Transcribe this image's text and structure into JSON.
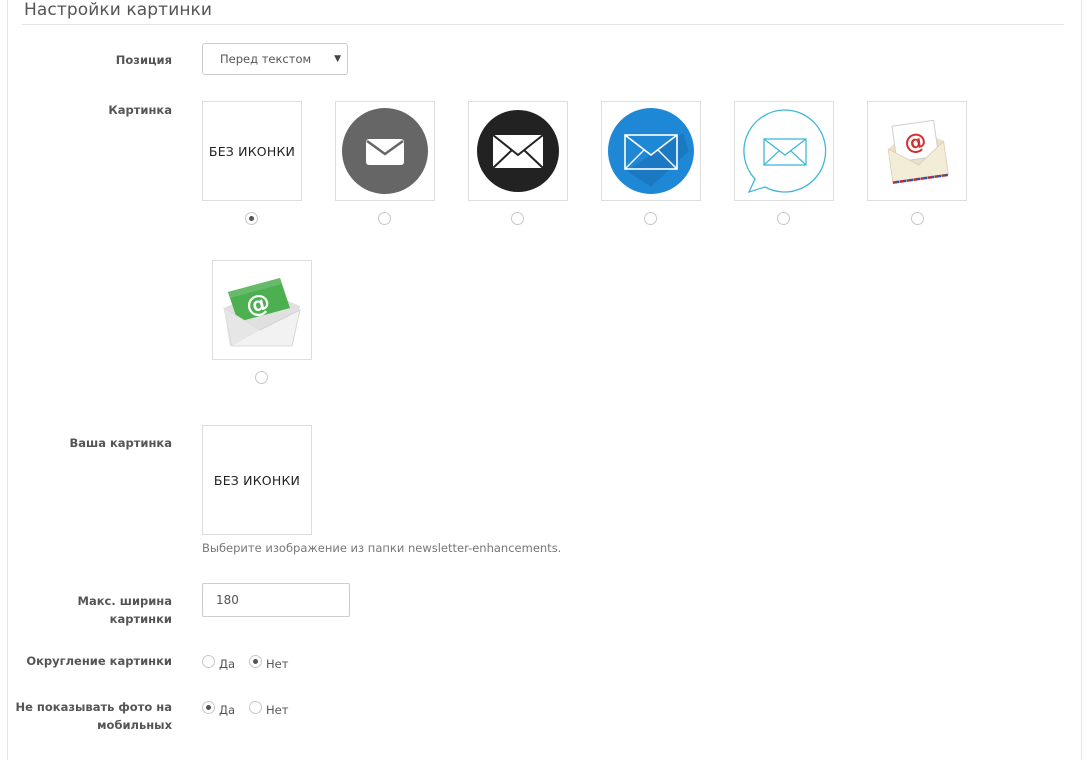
{
  "section": {
    "title": "Настройки картинки"
  },
  "position": {
    "label": "Позиция",
    "value": "Перед текстом"
  },
  "picture": {
    "label": "Картинка",
    "no_icon_text": "БЕЗ ИКОНКИ",
    "options": [
      {
        "icon": "no-icon",
        "selected": true
      },
      {
        "icon": "envelope-gray-circle-icon",
        "selected": false
      },
      {
        "icon": "envelope-black-circle-icon",
        "selected": false
      },
      {
        "icon": "envelope-blue-circle-icon",
        "selected": false
      },
      {
        "icon": "envelope-outline-bubble-icon",
        "selected": false
      },
      {
        "icon": "envelope-at-letter-icon",
        "selected": false
      },
      {
        "icon": "envelope-green-at-icon",
        "selected": false
      }
    ]
  },
  "your_picture": {
    "label": "Ваша картинка",
    "preview_text": "БЕЗ ИКОНКИ",
    "hint": "Выберите изображение из папки newsletter-enhancements."
  },
  "max_width": {
    "label_line1": "Макс. ширина",
    "label_line2": "картинки",
    "value": "180"
  },
  "rounding": {
    "label": "Округление картинки",
    "yes": "Да",
    "no": "Нет",
    "selected": "no"
  },
  "hide_mobile": {
    "label_line1": "Не показывать фото на",
    "label_line2": "мобильных",
    "yes": "Да",
    "no": "Нет",
    "selected": "yes"
  },
  "colors": {
    "blue": "#1e88d6",
    "gray": "#666666",
    "green": "#4caf50",
    "at_red": "#d32f2f"
  }
}
